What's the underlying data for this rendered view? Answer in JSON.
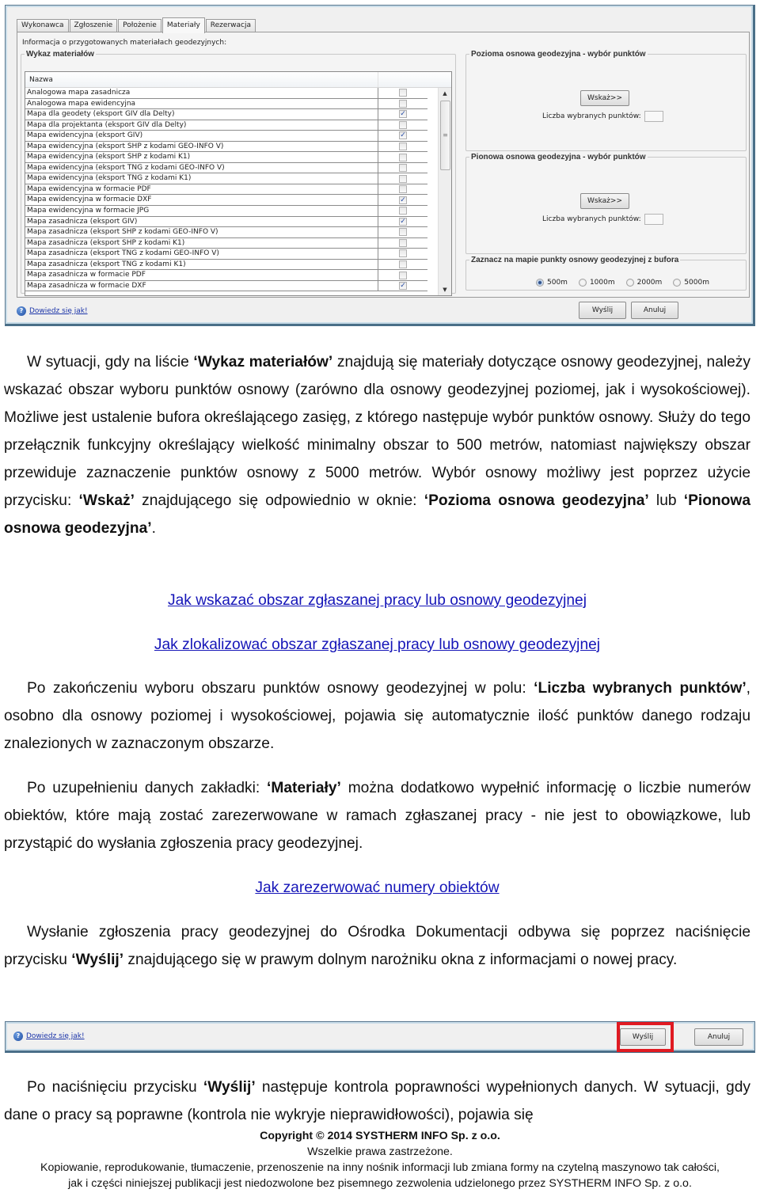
{
  "dialog": {
    "tabs": [
      {
        "label": "Wykonawca",
        "active": false
      },
      {
        "label": "Zgłoszenie",
        "active": false
      },
      {
        "label": "Położenie",
        "active": false
      },
      {
        "label": "Materiały",
        "active": true
      },
      {
        "label": "Rezerwacja",
        "active": false
      }
    ],
    "info_label": "Informacja o przygotowanych materiałach geodezyjnych:",
    "materials_group": {
      "title": "Wykaz materiałów",
      "column_name": "Nazwa",
      "rows": [
        {
          "name": "Analogowa mapa zasadnicza",
          "checked": false
        },
        {
          "name": "Analogowa mapa ewidencyjna",
          "checked": false
        },
        {
          "name": "Mapa dla geodety (eksport GIV dla Delty)",
          "checked": true
        },
        {
          "name": "Mapa dla projektanta (eksport GIV dla Delty)",
          "checked": false
        },
        {
          "name": "Mapa ewidencyjna (eksport GIV)",
          "checked": true
        },
        {
          "name": "Mapa ewidencyjna (eksport SHP z kodami GEO-INFO V)",
          "checked": false
        },
        {
          "name": "Mapa ewidencyjna (eksport SHP z kodami K1)",
          "checked": false
        },
        {
          "name": "Mapa ewidencyjna (eksport TNG z kodami GEO-INFO V)",
          "checked": false
        },
        {
          "name": "Mapa ewidencyjna (eksport TNG z kodami K1)",
          "checked": false
        },
        {
          "name": "Mapa ewidencyjna w formacie PDF",
          "checked": false
        },
        {
          "name": "Mapa ewidencyjna w formacie DXF",
          "checked": true
        },
        {
          "name": "Mapa ewidencyjna w formacie JPG",
          "checked": false
        },
        {
          "name": "Mapa zasadnicza (eksport GIV)",
          "checked": true
        },
        {
          "name": "Mapa zasadnicza (eksport SHP z kodami GEO-INFO V)",
          "checked": false
        },
        {
          "name": "Mapa zasadnicza (eksport SHP z kodami K1)",
          "checked": false
        },
        {
          "name": "Mapa zasadnicza (eksport TNG z kodami GEO-INFO V)",
          "checked": false
        },
        {
          "name": "Mapa zasadnicza (eksport TNG z kodami K1)",
          "checked": false
        },
        {
          "name": "Mapa zasadnicza w formacie PDF",
          "checked": false
        },
        {
          "name": "Mapa zasadnicza w formacie DXF",
          "checked": true
        }
      ]
    },
    "horizontal_group": {
      "title": "Pozioma osnowa geodezyjna - wybór punktów",
      "button": "Wskaż>>",
      "count_label": "Liczba wybranych punktów:",
      "count_value": ""
    },
    "vertical_group": {
      "title": "Pionowa osnowa geodezyjna - wybór punktów",
      "button": "Wskaż>>",
      "count_label": "Liczba wybranych punktów:",
      "count_value": ""
    },
    "buffer_group": {
      "title": "Zaznacz na mapie punkty osnowy geodezyjnej z bufora",
      "options": [
        {
          "label": "500m",
          "selected": true
        },
        {
          "label": "1000m",
          "selected": false
        },
        {
          "label": "2000m",
          "selected": false
        },
        {
          "label": "5000m",
          "selected": false
        }
      ]
    },
    "help_link": "Dowiedz się jak!",
    "send_button": "Wyślij",
    "cancel_button": "Anuluj"
  },
  "text": {
    "p1": [
      "W sytuacji, gdy na liście ",
      "‘Wykaz materiałów’",
      " znajdują się materiały dotyczące osnowy geodezyjnej, należy wskazać obszar wyboru punktów osnowy (zarówno dla osnowy geodezyjnej poziomej, jak i wysokościowej). Możliwe jest ustalenie bufora określającego zasięg, z którego następuje wybór punktów osnowy. Służy do tego przełącznik funkcyjny określający wielkość minimalny obszar to 500 metrów, natomiast największy obszar przewiduje zaznaczenie punktów osnowy z 5000 metrów. Wybór osnowy możliwy jest poprzez użycie przycisku: ",
      "‘Wskaż’",
      " znajdującego się odpowiednio w oknie: ",
      "‘Pozioma osnowa geodezyjna’",
      " lub ",
      "‘Pionowa osnowa geodezyjna’",
      "."
    ],
    "link1": "Jak wskazać obszar zgłaszanej pracy lub osnowy geodezyjnej",
    "link2": "Jak zlokalizować obszar zgłaszanej pracy lub osnowy geodezyjnej",
    "p2": [
      "Po zakończeniu wyboru obszaru punktów osnowy geodezyjnej w polu: ",
      "‘Liczba wybranych punktów’",
      ", osobno dla osnowy poziomej i wysokościowej, pojawia się automatycznie ilość punktów danego rodzaju znalezionych w zaznaczonym obszarze."
    ],
    "p3": [
      "Po uzupełnieniu danych zakładki: ",
      "‘Materiały’",
      " można dodatkowo wypełnić informację o liczbie numerów obiektów, które mają zostać zarezerwowane w ramach zgłaszanej pracy - nie jest to obowiązkowe, lub przystąpić do wysłania zgłoszenia pracy geodezyjnej."
    ],
    "link3": "Jak zarezerwować numery obiektów",
    "p4": [
      "Wysłanie zgłoszenia pracy geodezyjnej do Ośrodka Dokumentacji odbywa się poprzez naciśnięcie przycisku ",
      "‘Wyślij’",
      " znajdującego się w prawym dolnym narożniku okna z informacjami o nowej pracy."
    ],
    "p5": [
      "Po naciśnięciu przycisku ",
      "‘Wyślij’",
      " następuje kontrola poprawności wypełnionych danych. W sytuacji, gdy dane o pracy są poprawne (kontrola nie wykryje nieprawidłowości), pojawia się"
    ]
  },
  "bar": {
    "help_link": "Dowiedz się jak!",
    "send_button": "Wyślij",
    "cancel_button": "Anuluj",
    "highlight_color": "#e01a22"
  },
  "footer": {
    "copyright": "Copyright © 2014 SYSTHERM INFO Sp. z o.o.",
    "rights": "Wszelkie prawa zastrzeżone.",
    "notice_line1": "Kopiowanie, reprodukowanie, tłumaczenie, przenoszenie na inny nośnik informacji lub zmiana formy na czytelną maszynowo tak całości,",
    "notice_line2": "jak i części niniejszej publikacji jest niedozwolone bez pisemnego zezwolenia udzielonego przez SYSTHERM INFO Sp. z o.o."
  }
}
